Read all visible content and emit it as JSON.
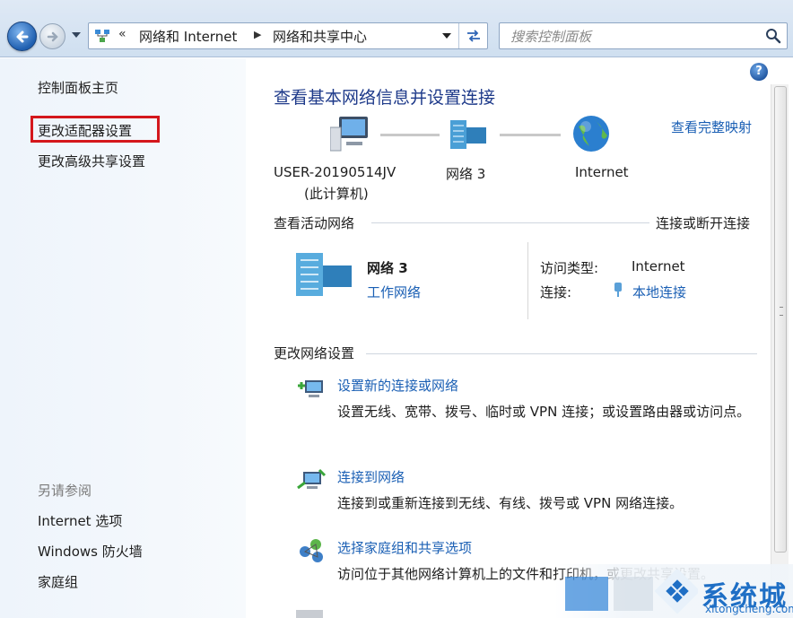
{
  "address_bar": {
    "overflow_chevron": "«",
    "crumbs": [
      "网络和 Internet",
      "网络和共享中心"
    ],
    "separator": "▶"
  },
  "search": {
    "placeholder": "搜索控制面板"
  },
  "left_pane": {
    "items": [
      "控制面板主页",
      "更改适配器设置",
      "更改高级共享设置"
    ],
    "highlighted_item": "更改适配器设置",
    "see_also_heading": "另请参阅",
    "see_also": [
      "Internet 选项",
      "Windows 防火墙",
      "家庭组"
    ]
  },
  "main": {
    "title": "查看基本网络信息并设置连接",
    "full_map_link": "查看完整映射",
    "network_map": {
      "computer_label": "USER-20190514JV",
      "computer_sub": "(此计算机)",
      "network_label": "网络  3",
      "internet_label": "Internet"
    },
    "active_networks": {
      "heading": "查看活动网络",
      "link": "连接或断开连接",
      "network_name": "网络  3",
      "network_type": "工作网络",
      "access_type_key": "访问类型:",
      "access_type_val": "Internet",
      "connection_key": "连接:",
      "connection_val": "本地连接"
    },
    "change_settings": {
      "heading": "更改网络设置",
      "tasks": [
        {
          "title": "设置新的连接或网络",
          "desc": "设置无线、宽带、拨号、临时或 VPN 连接；或设置路由器或访问点。"
        },
        {
          "title": "连接到网络",
          "desc": "连接到或重新连接到无线、有线、拨号或 VPN 网络连接。"
        },
        {
          "title": "选择家庭组和共享选项",
          "desc": "访问位于其他网络计算机上的文件和打印机，或更改共享设置。"
        }
      ]
    }
  },
  "watermark": {
    "brand": "系统城",
    "url": "xitongcheng.com"
  },
  "colors": {
    "link": "#1a5fb4",
    "title": "#1e3a8a",
    "highlight_box": "#d4171c"
  }
}
